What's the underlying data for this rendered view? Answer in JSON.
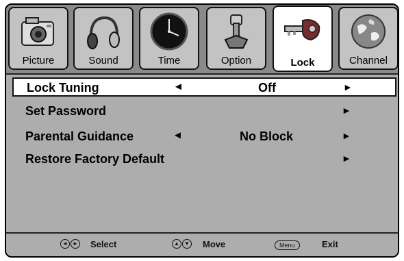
{
  "tabs": [
    {
      "label": "Picture",
      "icon": "camera-icon",
      "active": false
    },
    {
      "label": "Sound",
      "icon": "headphones-icon",
      "active": false
    },
    {
      "label": "Time",
      "icon": "clock-icon",
      "active": false
    },
    {
      "label": "Option",
      "icon": "wrench-icon",
      "active": false
    },
    {
      "label": "Lock",
      "icon": "key-lock-icon",
      "active": true
    },
    {
      "label": "Channel",
      "icon": "globe-icon",
      "active": false
    }
  ],
  "menu": {
    "items": [
      {
        "label": "Lock Tuning",
        "value": "Off",
        "left_arrow": "◄",
        "right_arrow": "►",
        "selected": true
      },
      {
        "label": "Set Password",
        "value": "",
        "left_arrow": "",
        "right_arrow": "►",
        "selected": false
      },
      {
        "label": "Parental Guidance",
        "value": "No Block",
        "left_arrow": "◄",
        "right_arrow": "►",
        "selected": false
      },
      {
        "label": "Restore Factory Default",
        "value": "",
        "left_arrow": "",
        "right_arrow": "►",
        "selected": false
      }
    ]
  },
  "footer": {
    "select_label": "Select",
    "move_label": "Move",
    "menu_key": "Menu",
    "exit_label": "Exit"
  },
  "colors": {
    "panel": "#adadad",
    "tabbar": "#8a8a8a",
    "highlight": "#ffffff"
  }
}
